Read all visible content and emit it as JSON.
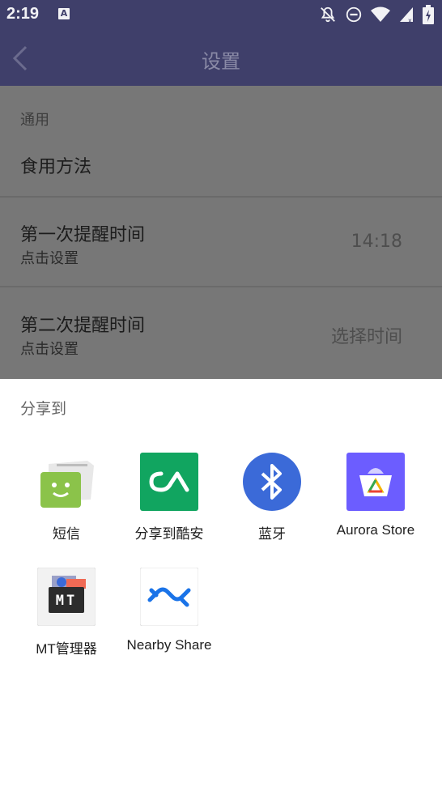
{
  "status_bar": {
    "time": "2:19",
    "notification_icon_letter": "A",
    "icons": [
      "notifications-off-icon",
      "do-not-disturb-icon",
      "wifi-icon",
      "signal-icon",
      "battery-icon"
    ]
  },
  "app_bar": {
    "title": "设置",
    "back_icon": "chevron-left-icon"
  },
  "settings": {
    "section_header": "通用",
    "items": [
      {
        "title": "食用方法"
      },
      {
        "title": "第一次提醒时间",
        "subtitle": "点击设置",
        "value": "14:18"
      },
      {
        "title": "第二次提醒时间",
        "subtitle": "点击设置",
        "value": "选择时间"
      }
    ]
  },
  "share_sheet": {
    "title": "分享到",
    "targets": [
      {
        "label": "短信",
        "icon": "messaging-icon"
      },
      {
        "label": "分享到酷安",
        "icon": "coolapk-icon"
      },
      {
        "label": "蓝牙",
        "icon": "bluetooth-icon"
      },
      {
        "label": "Aurora Store",
        "icon": "aurora-store-icon"
      },
      {
        "label": "MT管理器",
        "icon": "mt-manager-icon",
        "icon_text": "MT"
      },
      {
        "label": "Nearby Share",
        "icon": "nearby-share-icon"
      }
    ]
  },
  "colors": {
    "app_bar": "#3f3f6a",
    "scrim_background": "#777777",
    "sheet_background": "#ffffff",
    "coolapk_green": "#11a560",
    "bluetooth_blue": "#3b6ad8",
    "aurora_purple": "#6c5dff"
  }
}
